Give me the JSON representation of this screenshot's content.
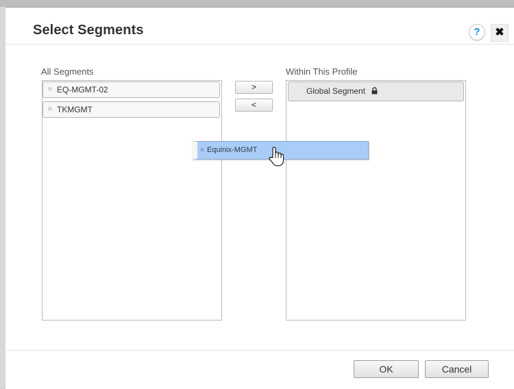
{
  "dialog": {
    "title": "Select Segments",
    "help_label": "?",
    "close_label": "✖"
  },
  "all_segments": {
    "label": "All Segments",
    "items": [
      {
        "label": "EQ-MGMT-02"
      },
      {
        "label": "TKMGMT"
      }
    ]
  },
  "within_profile": {
    "label": "Within This Profile",
    "items": [
      {
        "label": "Global Segment",
        "locked": true
      }
    ]
  },
  "move_buttons": {
    "add_label": ">",
    "remove_label": "<"
  },
  "drag": {
    "item_label": "Equinix-MGMT",
    "cursor": "hand-pointer-icon"
  },
  "footer": {
    "ok_label": "OK",
    "cancel_label": "Cancel"
  },
  "icons": {
    "grip": "drag-grip-icon",
    "lock": "lock-icon",
    "help": "help-icon",
    "close": "close-icon"
  },
  "colors": {
    "drag_highlight": "#a9cdf7",
    "help_accent": "#1a8fd2",
    "title": "#333333"
  }
}
